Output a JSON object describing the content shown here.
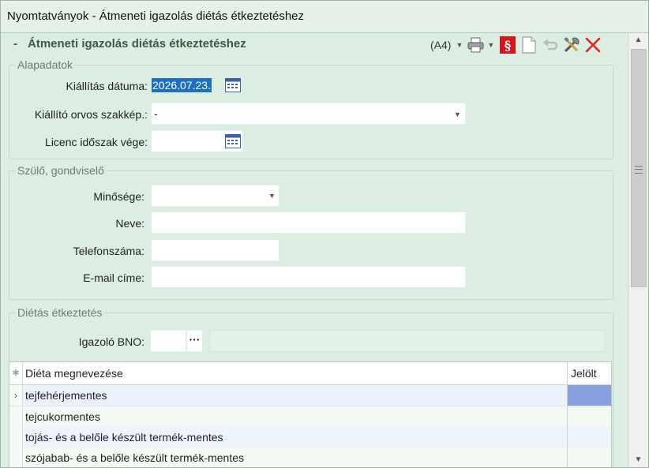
{
  "window": {
    "title": "Nyomtatványok  -  Átmeneti igazolás diétás étkeztetéshez"
  },
  "header": {
    "collapse_symbol": "-",
    "title": "Átmeneti igazolás diétás étkeztetéshez",
    "paper_size": "(A4)"
  },
  "colors": {
    "title_green": "#3a5b46",
    "panel_bg": "#dcede2",
    "selection_blue": "#1e6fc4",
    "marked_cell": "#8aa0de"
  },
  "groups": {
    "alapadatok": {
      "title": "Alapadatok",
      "issue_date_label": "Kiállítás dátuma:",
      "issue_date_value": "2026.07.23.",
      "doctor_specialty_label": "Kiállító orvos szakkép.:",
      "doctor_specialty_value": "-",
      "license_end_label": "Licenc időszak vége:",
      "license_end_value": ""
    },
    "guardian": {
      "title": "Szülő, gondviselő",
      "role_label": "Minősége:",
      "role_value": "",
      "name_label": "Neve:",
      "name_value": "",
      "phone_label": "Telefonszáma:",
      "phone_value": "",
      "email_label": "E-mail címe:",
      "email_value": ""
    },
    "diet": {
      "title": "Diétás étkeztetés",
      "bno_label": "Igazoló BNO:",
      "bno_value": "",
      "bno_button": "···",
      "bno_description": ""
    }
  },
  "grid": {
    "columns": {
      "name": "Diéta megnevezése",
      "marked": "Jelölt"
    },
    "rows": [
      {
        "name": "tejfehérjementes",
        "current": true
      },
      {
        "name": "tejcukormentes",
        "current": false
      },
      {
        "name": "tojás- és a belőle készült termék-mentes",
        "current": false
      },
      {
        "name": "szójabab- és a belőle készült termék-mentes",
        "current": false
      }
    ],
    "current_indicator": "›",
    "header_star": "✱"
  },
  "icons": [
    "printer-icon",
    "paragraph-icon",
    "document-icon",
    "undo-icon",
    "tools-icon",
    "close-icon",
    "calendar-icon",
    "dropdown-caret-icon",
    "chevron-right-icon"
  ]
}
